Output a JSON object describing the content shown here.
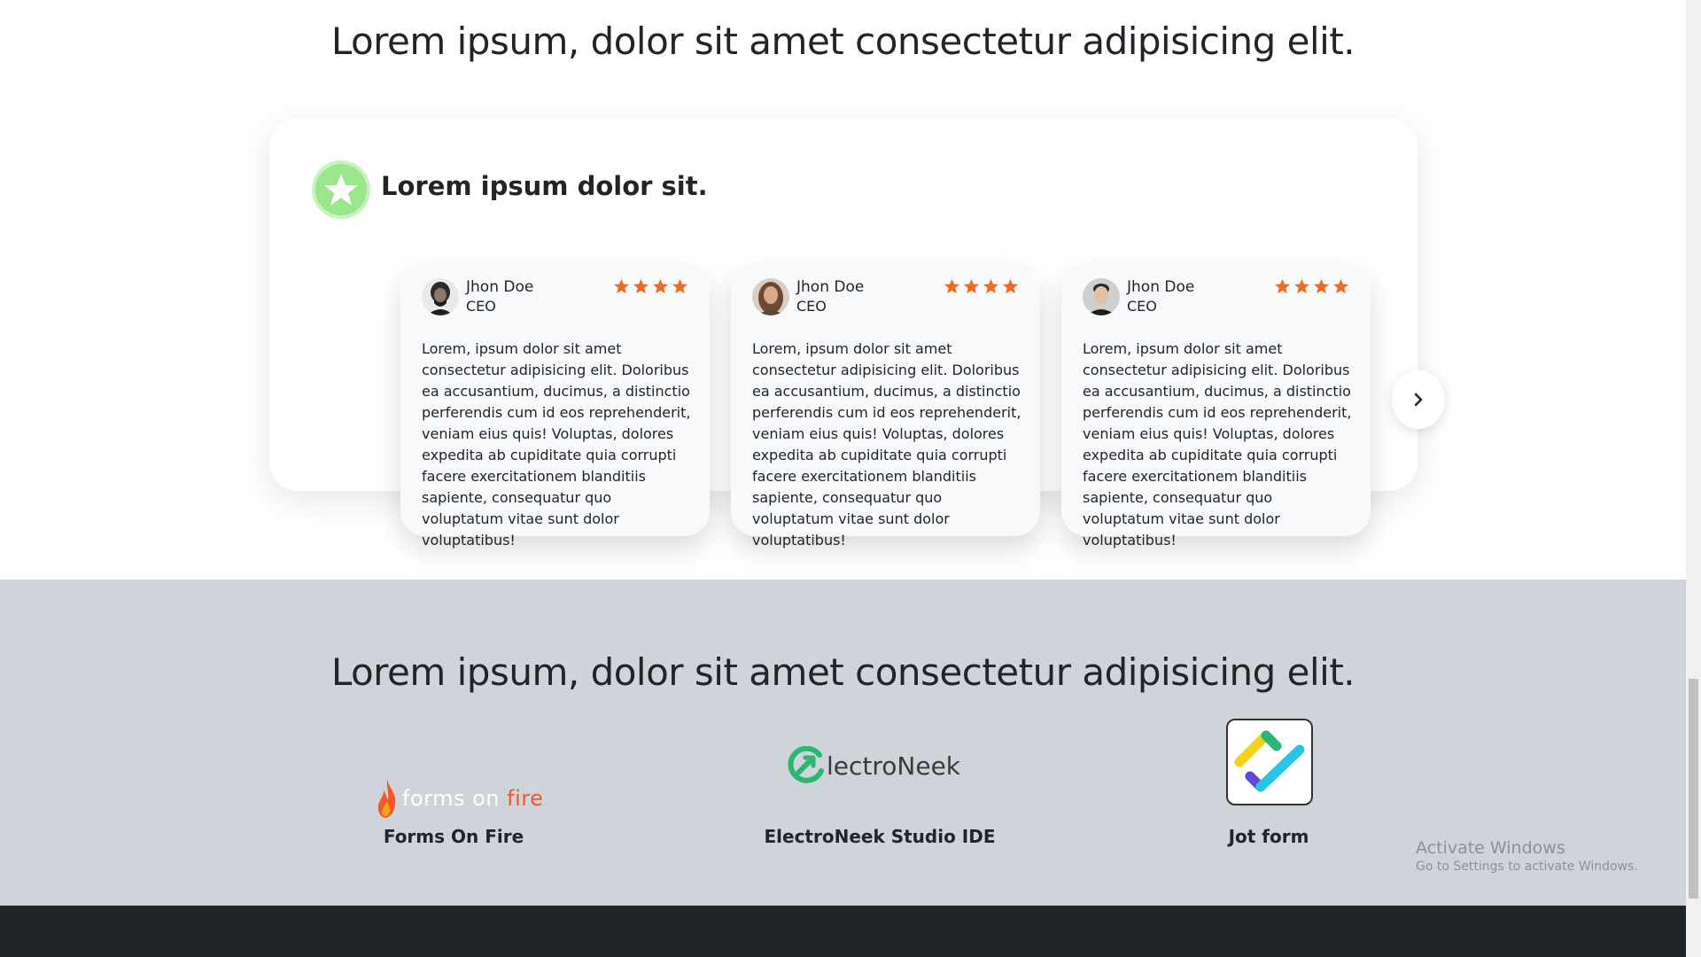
{
  "testimonials": {
    "heading": "Lorem ipsum, dolor sit amet consectetur adipisicing elit.",
    "panel_title": "Lorem ipsum dolor sit.",
    "badge_icon": "star-icon",
    "next_icon": "chevron-right-icon",
    "cards": [
      {
        "name": "Jhon Doe",
        "role": "CEO",
        "rating": 4,
        "text": "Lorem, ipsum dolor sit amet consectetur adipisicing elit. Doloribus ea accusantium, ducimus, a distinctio perferendis cum id eos reprehenderit, veniam eius quis! Voluptas, dolores expedita ab cupiditate quia corrupti facere exercitationem blanditiis sapiente, consequatur quo voluptatum vitae sunt dolor voluptatibus!"
      },
      {
        "name": "Jhon Doe",
        "role": "CEO",
        "rating": 4,
        "text": "Lorem, ipsum dolor sit amet consectetur adipisicing elit. Doloribus ea accusantium, ducimus, a distinctio perferendis cum id eos reprehenderit, veniam eius quis! Voluptas, dolores expedita ab cupiditate quia corrupti facere exercitationem blanditiis sapiente, consequatur quo voluptatum vitae sunt dolor voluptatibus!"
      },
      {
        "name": "Jhon Doe",
        "role": "CEO",
        "rating": 4,
        "text": "Lorem, ipsum dolor sit amet consectetur adipisicing elit. Doloribus ea accusantium, ducimus, a distinctio perferendis cum id eos reprehenderit, veniam eius quis! Voluptas, dolores expedita ab cupiditate quia corrupti facere exercitationem blanditiis sapiente, consequatur quo voluptatum vitae sunt dolor voluptatibus!"
      }
    ]
  },
  "partners": {
    "heading": "Lorem ipsum, dolor sit amet consectetur adipisicing elit.",
    "items": [
      {
        "name": "Forms On Fire",
        "logo_word1": "forms on ",
        "logo_word2": "fire"
      },
      {
        "name": "ElectroNeek Studio IDE",
        "logo_text": "lectroNeek"
      },
      {
        "name": "Jot form"
      }
    ]
  },
  "watermark": {
    "line1": "Activate Windows",
    "line2": "Go to Settings to activate Windows."
  },
  "colors": {
    "star": "#f26b1d",
    "badge": "#9be58c",
    "partners_bg": "#ced4da",
    "footer_bg": "#212529"
  }
}
